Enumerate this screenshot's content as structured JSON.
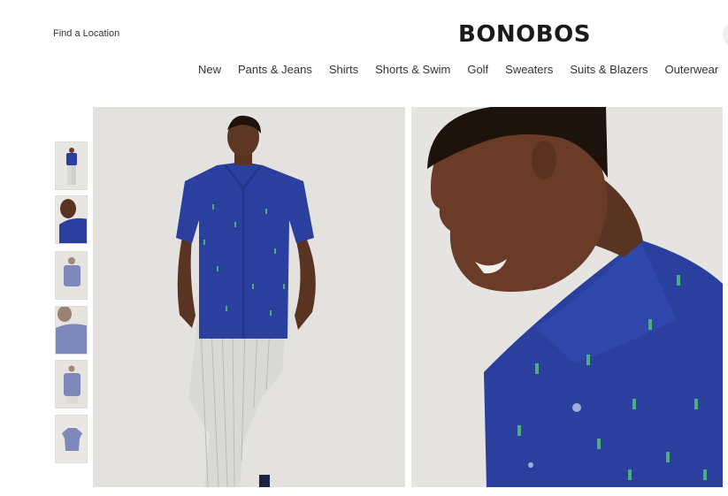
{
  "header": {
    "find_location": "Find a Location",
    "logo": "BONOBOS"
  },
  "nav": {
    "items": [
      "New",
      "Pants & Jeans",
      "Shirts",
      "Shorts & Swim",
      "Golf",
      "Sweaters",
      "Suits & Blazers",
      "Outerwear"
    ]
  },
  "colors": {
    "shirt_blue": "#2a3f9e",
    "background": "#ffffff",
    "photo_backdrop": "#e6e3de"
  }
}
